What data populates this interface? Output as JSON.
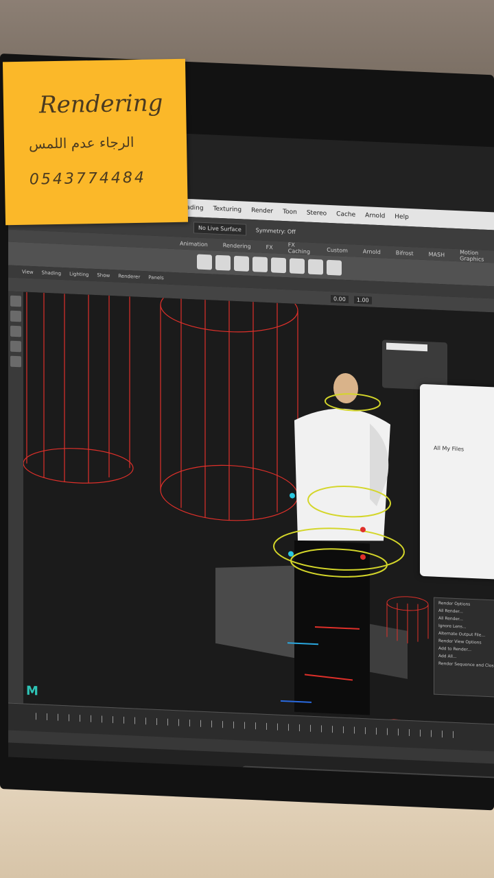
{
  "sticky_note": {
    "title": "Rendering",
    "arabic_text": "الرجاء عدم اللمس",
    "phone": "0543774484"
  },
  "maya": {
    "menu": [
      "Shading",
      "Texturing",
      "Render",
      "Toon",
      "Stereo",
      "Cache",
      "Arnold",
      "Help"
    ],
    "live_surface": "No Live Surface",
    "symmetry": "Symmetry: Off",
    "shelf_tabs": [
      "Animation",
      "Rendering",
      "FX",
      "FX Caching",
      "Custom",
      "Arnold",
      "Bifrost",
      "MASH",
      "Motion Graphics"
    ],
    "panel_menu": [
      "View",
      "Shading",
      "Lighting",
      "Show",
      "Renderer",
      "Panels"
    ],
    "field_values": [
      "0.00",
      "1.00"
    ],
    "logo": "M"
  },
  "file_panel": {
    "title": "All My Files"
  },
  "render_options": {
    "title": "Render Options",
    "items": [
      "All Render...",
      "All Render...",
      "Ignore Lens...",
      "Alternate Output File...",
      "Render View Options",
      "Add to Render...",
      "Add All...",
      "Render Sequence and Close"
    ]
  },
  "dock_icons": [
    "finder-icon",
    "rocket-icon",
    "photo-booth-icon",
    "safari-icon",
    "mail-icon",
    "notes-icon",
    "calendar-icon",
    "reminders-icon",
    "stickies-icon"
  ],
  "colors": {
    "sticky": "#fbb829",
    "wireframe_red": "#e0302a",
    "control_yellow": "#d4d62a",
    "control_blue": "#2aa8e0"
  }
}
